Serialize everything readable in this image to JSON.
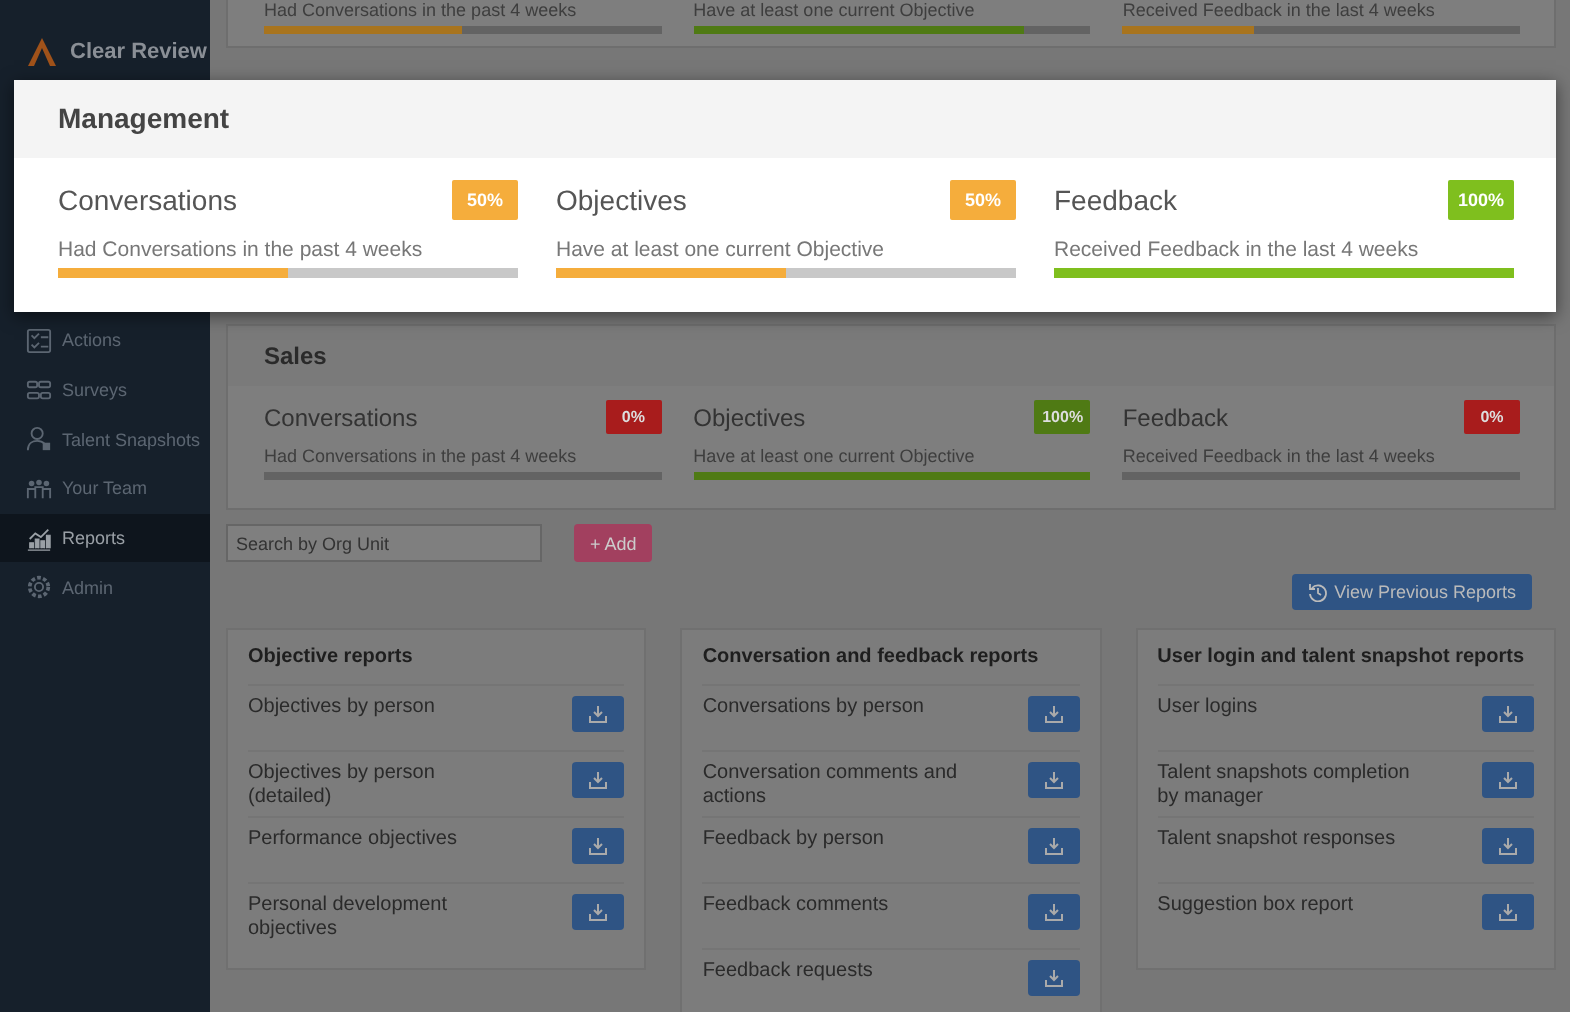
{
  "logo": {
    "text": "Clear Review"
  },
  "nav": [
    {
      "label": "Actions",
      "selected": false
    },
    {
      "label": "Surveys",
      "selected": false
    },
    {
      "label": "Talent Snapshots",
      "selected": false
    },
    {
      "label": "Your Team",
      "selected": false
    },
    {
      "label": "Reports",
      "selected": true
    },
    {
      "label": "Admin",
      "selected": false
    }
  ],
  "previous_unit": {
    "metrics": [
      {
        "description": "Had Conversations in the past 4 weeks",
        "level": 0.5,
        "color": "#a8741e"
      },
      {
        "description": "Have at least one current Objective",
        "level": 0.83,
        "color": "#4f7a14"
      },
      {
        "description": "Received Feedback in the last 4 weeks",
        "level": 0.33,
        "color": "#a8741e"
      }
    ]
  },
  "highlighted_unit": {
    "title": "Management",
    "metrics": [
      {
        "title": "Conversations",
        "badge": "50%",
        "description": "Had Conversations in the past 4 weeks",
        "level": 0.5,
        "color": "#f5ad3c"
      },
      {
        "title": "Objectives",
        "badge": "50%",
        "description": "Have at least one current Objective",
        "level": 0.5,
        "color": "#f5ad3c"
      },
      {
        "title": "Feedback",
        "badge": "100%",
        "description": "Received Feedback in the last 4 weeks",
        "level": 1,
        "color": "#7fbf1e"
      }
    ]
  },
  "next_unit": {
    "title": "Sales",
    "metrics": [
      {
        "title": "Conversations",
        "badge": "0%",
        "description": "Had Conversations in the past 4 weeks",
        "level": 0,
        "color": "#a81c1c"
      },
      {
        "title": "Objectives",
        "badge": "100%",
        "description": "Have at least one current Objective",
        "level": 1,
        "color": "#4f7a14"
      },
      {
        "title": "Feedback",
        "badge": "0%",
        "description": "Received Feedback in the last 4 weeks",
        "level": 0,
        "color": "#a81c1c"
      }
    ]
  },
  "search": {
    "placeholder": "Search by Org Unit"
  },
  "add_button": "+ Add",
  "view_previous_button": "View Previous Reports",
  "report_groups": [
    {
      "title": "Objective reports",
      "items": [
        "Objectives by person",
        "Objectives by person (detailed)",
        "Performance objectives",
        "Personal development objectives"
      ]
    },
    {
      "title": "Conversation and feedback reports",
      "items": [
        "Conversations by person",
        "Conversation comments and actions",
        "Feedback by person",
        "Feedback comments",
        "Feedback requests"
      ]
    },
    {
      "title": "User login and talent snapshot reports",
      "items": [
        "User logins",
        "Talent snapshots completion by manager",
        "Talent snapshot responses",
        "Suggestion box report"
      ]
    }
  ]
}
